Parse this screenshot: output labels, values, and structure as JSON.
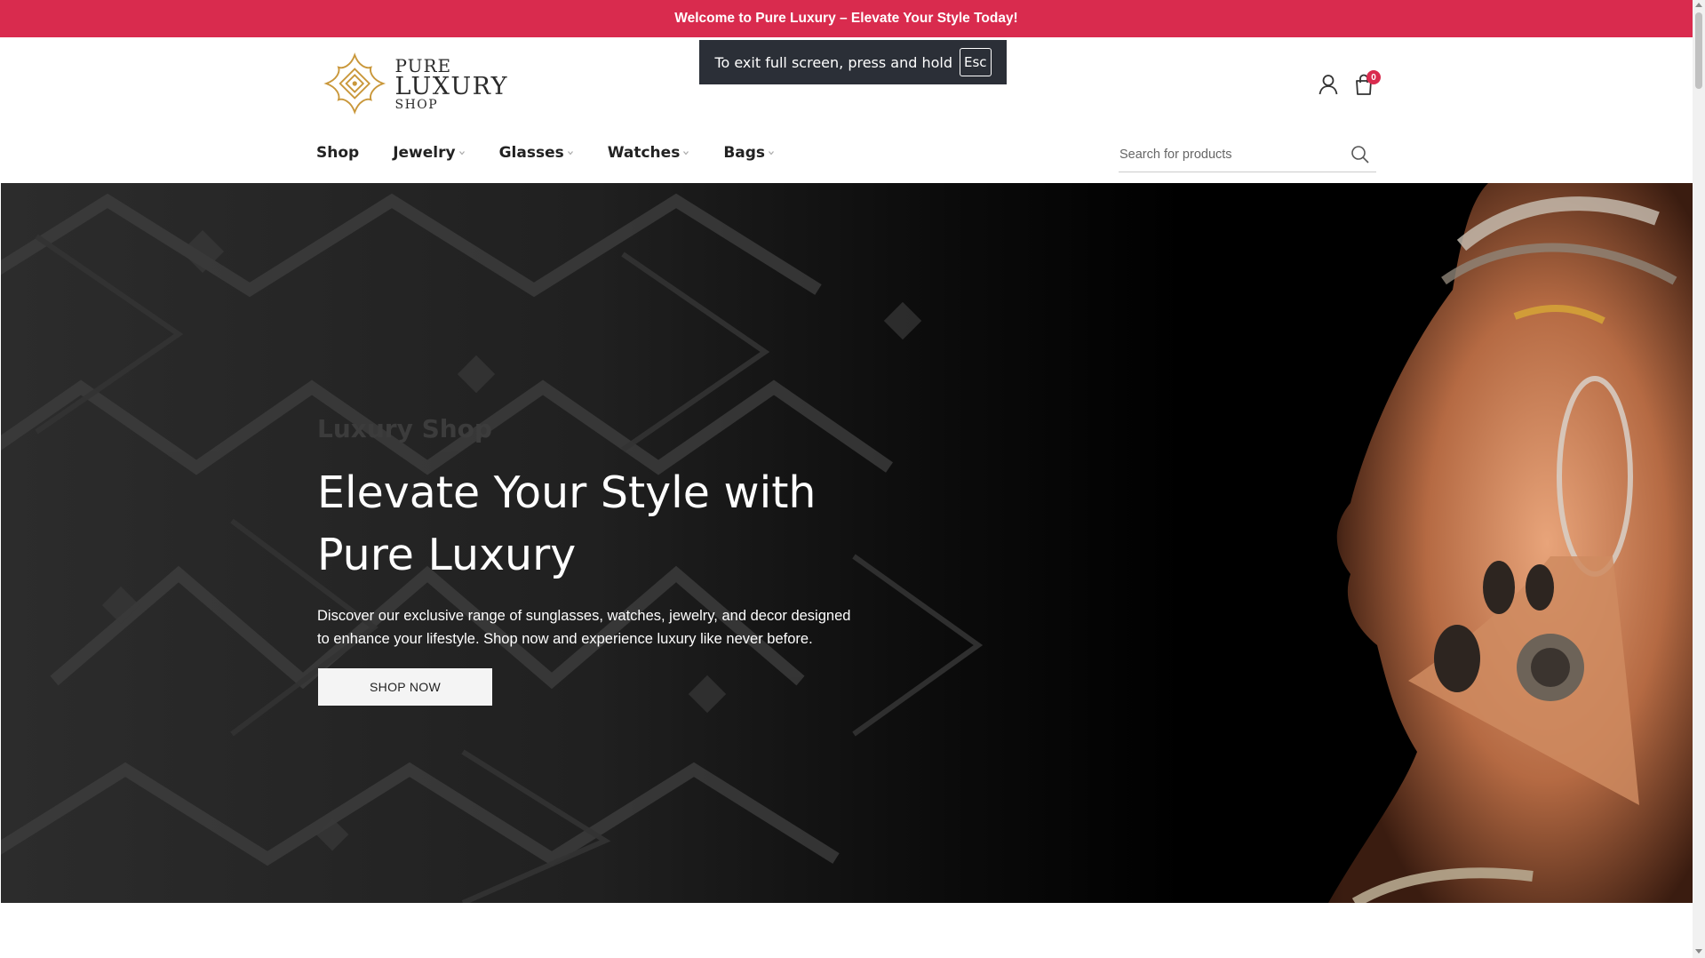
{
  "announcement": "Welcome to Pure Luxury – Elevate Your Style Today!",
  "fullscreen_notice": {
    "text": "To exit full screen, press and hold",
    "key": "Esc"
  },
  "logo": {
    "line1": "PURE",
    "line2": "LUXURY",
    "line3": "SHOP"
  },
  "cart": {
    "count": "0"
  },
  "nav": [
    {
      "label": "Shop",
      "has_dropdown": false
    },
    {
      "label": "Jewelry",
      "has_dropdown": true
    },
    {
      "label": "Glasses",
      "has_dropdown": true
    },
    {
      "label": "Watches",
      "has_dropdown": true
    },
    {
      "label": "Bags",
      "has_dropdown": true
    }
  ],
  "search": {
    "placeholder": "Search for products"
  },
  "hero": {
    "subtitle": "Luxury Shop",
    "title": "Elevate Your Style with Pure Luxury",
    "description": "Discover our exclusive range of sunglasses, watches, jewelry, and decor designed to enhance your lifestyle. Shop now and experience luxury like never before.",
    "button": "SHOP NOW"
  },
  "colors": {
    "accent": "#d92b4e",
    "logo_gold": "#c9973a"
  },
  "icons": [
    "user-icon",
    "cart-icon",
    "search-icon",
    "chevron-down-icon"
  ]
}
